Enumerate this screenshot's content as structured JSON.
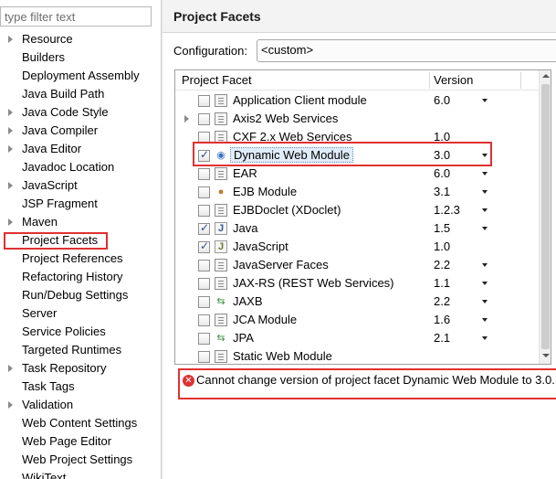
{
  "filter": {
    "placeholder": "type filter text"
  },
  "nav": {
    "items": [
      {
        "label": "Resource",
        "expandable": true
      },
      {
        "label": "Builders",
        "expandable": false
      },
      {
        "label": "Deployment Assembly",
        "expandable": false
      },
      {
        "label": "Java Build Path",
        "expandable": false
      },
      {
        "label": "Java Code Style",
        "expandable": true
      },
      {
        "label": "Java Compiler",
        "expandable": true
      },
      {
        "label": "Java Editor",
        "expandable": true
      },
      {
        "label": "Javadoc Location",
        "expandable": false
      },
      {
        "label": "JavaScript",
        "expandable": true
      },
      {
        "label": "JSP Fragment",
        "expandable": false
      },
      {
        "label": "Maven",
        "expandable": true
      },
      {
        "label": "Project Facets",
        "expandable": false,
        "selected": true
      },
      {
        "label": "Project References",
        "expandable": false
      },
      {
        "label": "Refactoring History",
        "expandable": false
      },
      {
        "label": "Run/Debug Settings",
        "expandable": false
      },
      {
        "label": "Server",
        "expandable": false
      },
      {
        "label": "Service Policies",
        "expandable": false
      },
      {
        "label": "Targeted Runtimes",
        "expandable": false
      },
      {
        "label": "Task Repository",
        "expandable": true
      },
      {
        "label": "Task Tags",
        "expandable": false
      },
      {
        "label": "Validation",
        "expandable": true
      },
      {
        "label": "Web Content Settings",
        "expandable": false
      },
      {
        "label": "Web Page Editor",
        "expandable": false
      },
      {
        "label": "Web Project Settings",
        "expandable": false
      },
      {
        "label": "WikiText",
        "expandable": false
      }
    ]
  },
  "page": {
    "title": "Project Facets",
    "configuration_label": "Configuration:",
    "configuration_value": "<custom>"
  },
  "table": {
    "columns": [
      "Project Facet",
      "Version"
    ],
    "rows": [
      {
        "label": "Application Client module",
        "version": "6.0",
        "checked": false,
        "dropdown": true,
        "expandable": false,
        "icon": "page-icon"
      },
      {
        "label": "Axis2 Web Services",
        "version": "",
        "checked": false,
        "dropdown": false,
        "expandable": true,
        "icon": "page-icon"
      },
      {
        "label": "CXF 2.x Web Services",
        "version": "1.0",
        "checked": false,
        "dropdown": false,
        "expandable": false,
        "icon": "page-icon"
      },
      {
        "label": "Dynamic Web Module",
        "version": "3.0",
        "checked": true,
        "dropdown": true,
        "expandable": false,
        "icon": "globe-icon",
        "highlighted": true
      },
      {
        "label": "EAR",
        "version": "6.0",
        "checked": false,
        "dropdown": true,
        "expandable": false,
        "icon": "page-icon"
      },
      {
        "label": "EJB Module",
        "version": "3.1",
        "checked": false,
        "dropdown": true,
        "expandable": false,
        "icon": "bean-icon"
      },
      {
        "label": "EJBDoclet (XDoclet)",
        "version": "1.2.3",
        "checked": false,
        "dropdown": true,
        "expandable": false,
        "icon": "page-icon"
      },
      {
        "label": "Java",
        "version": "1.5",
        "checked": true,
        "dropdown": true,
        "expandable": false,
        "icon": "java-icon"
      },
      {
        "label": "JavaScript",
        "version": "1.0",
        "checked": true,
        "dropdown": false,
        "expandable": false,
        "icon": "javascript-icon"
      },
      {
        "label": "JavaServer Faces",
        "version": "2.2",
        "checked": false,
        "dropdown": true,
        "expandable": false,
        "icon": "page-icon"
      },
      {
        "label": "JAX-RS (REST Web Services)",
        "version": "1.1",
        "checked": false,
        "dropdown": true,
        "expandable": false,
        "icon": "page-icon"
      },
      {
        "label": "JAXB",
        "version": "2.2",
        "checked": false,
        "dropdown": true,
        "expandable": false,
        "icon": "arrows-icon"
      },
      {
        "label": "JCA Module",
        "version": "1.6",
        "checked": false,
        "dropdown": true,
        "expandable": false,
        "icon": "page-icon"
      },
      {
        "label": "JPA",
        "version": "2.1",
        "checked": false,
        "dropdown": true,
        "expandable": false,
        "icon": "arrows-icon"
      },
      {
        "label": "Static Web Module",
        "version": "",
        "checked": false,
        "dropdown": false,
        "expandable": false,
        "icon": "page-icon"
      }
    ]
  },
  "error": {
    "icon": "error-icon",
    "message": "Cannot change version of project facet Dynamic Web Module to 3.0."
  },
  "colors": {
    "annotation": "#e03030",
    "error_icon": "#dd3333",
    "check": "#2c4f8a"
  }
}
